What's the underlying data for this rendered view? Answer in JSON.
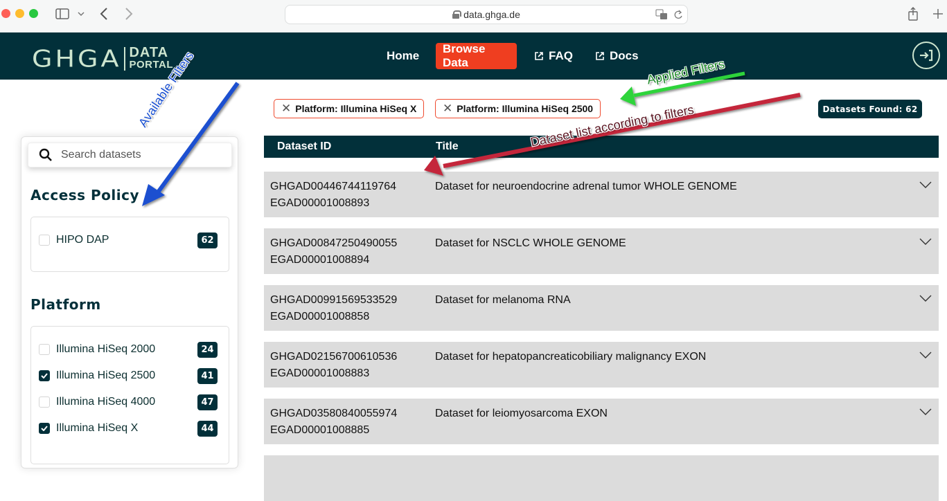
{
  "browser": {
    "url": "data.ghga.de",
    "icons": [
      "sidebar-toggle-icon",
      "chevron-down-icon",
      "back-icon",
      "forward-icon",
      "lock-icon",
      "translate-icon",
      "reload-icon",
      "share-icon",
      "new-tab-icon"
    ]
  },
  "header": {
    "logo_main": "GHGA",
    "logo_sub_1": "DATA",
    "logo_sub_2": "PORTAL",
    "nav": [
      {
        "label": "Home",
        "active": false,
        "external": false
      },
      {
        "label": "Browse Data",
        "active": true,
        "external": false
      },
      {
        "label": "FAQ",
        "active": false,
        "external": true
      },
      {
        "label": "Docs",
        "active": false,
        "external": true
      }
    ],
    "login_icon": "login-icon",
    "colors": {
      "background": "#02303a",
      "accent": "#ef3e20",
      "logo": "#cde5cf"
    }
  },
  "sidebar": {
    "search_placeholder": "Search datasets",
    "facets": [
      {
        "title": "Access Policy",
        "options": [
          {
            "label": "HIPO DAP",
            "count": "62",
            "checked": false
          }
        ]
      },
      {
        "title": "Platform",
        "options": [
          {
            "label": "Illumina HiSeq 2000",
            "count": "24",
            "checked": false
          },
          {
            "label": "Illumina HiSeq 2500",
            "count": "41",
            "checked": true
          },
          {
            "label": "Illumina HiSeq 4000",
            "count": "47",
            "checked": false
          },
          {
            "label": "Illumina HiSeq X",
            "count": "44",
            "checked": true
          }
        ]
      }
    ]
  },
  "filters": {
    "applied": [
      {
        "label": "Platform: Illumina HiSeq X"
      },
      {
        "label": "Platform: Illumina HiSeq 2500"
      }
    ],
    "datasets_found": "Datasets Found: 62"
  },
  "table": {
    "columns": [
      "Dataset ID",
      "Title"
    ],
    "rows": [
      {
        "ghga_id": "GHGAD00446744119764",
        "ega_id": "EGAD00001008893",
        "title": "Dataset for neuroendocrine adrenal tumor WHOLE GENOME"
      },
      {
        "ghga_id": "GHGAD00847250490055",
        "ega_id": "EGAD00001008894",
        "title": "Dataset for NSCLC WHOLE GENOME"
      },
      {
        "ghga_id": "GHGAD00991569533529",
        "ega_id": "EGAD00001008858",
        "title": "Dataset for melanoma RNA"
      },
      {
        "ghga_id": "GHGAD02156700610536",
        "ega_id": "EGAD00001008883",
        "title": "Dataset for hepatopancreaticobiliary malignancy EXON"
      },
      {
        "ghga_id": "GHGAD03580840055974",
        "ega_id": "EGAD00001008885",
        "title": "Dataset for leiomyosarcoma EXON"
      }
    ]
  },
  "annotations": {
    "available_filters": {
      "text": "Available Filters",
      "color": "#1a4fd0"
    },
    "applied_filters": {
      "text": "Applied Filters",
      "color": "#2ed43a"
    },
    "dataset_list": {
      "text": "Dataset list according to filters",
      "color": "#c4283a"
    }
  }
}
